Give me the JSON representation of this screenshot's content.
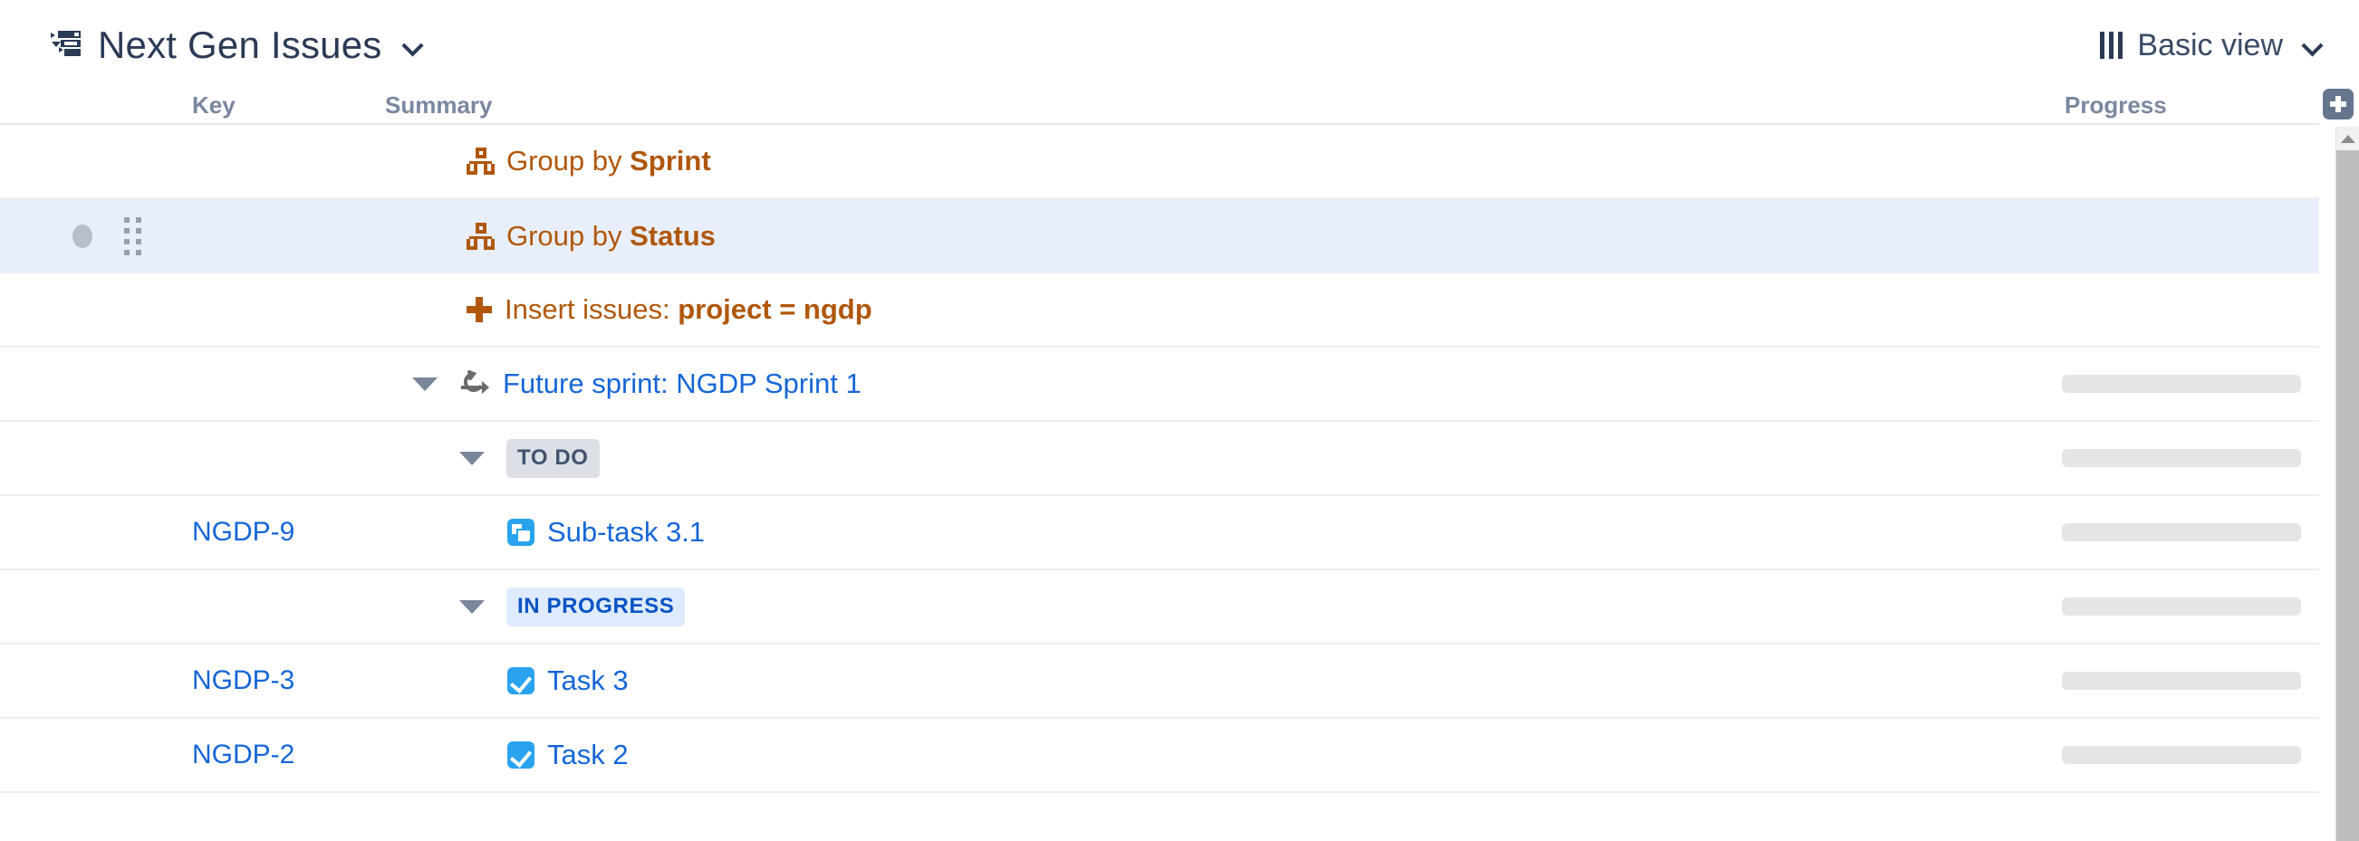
{
  "header": {
    "title": "Next Gen Issues",
    "title_icon": "structure-tree-icon",
    "title_chevron": "chevron-down-icon",
    "view_label": "Basic view",
    "view_icon": "columns-bars-icon",
    "view_chevron": "chevron-down-icon"
  },
  "columns": {
    "key": "Key",
    "summary": "Summary",
    "progress": "Progress",
    "add_column": "add-column-icon"
  },
  "colors": {
    "link_blue": "#1566d6",
    "group_orange": "#b0570b",
    "selected_row": "#e9effa",
    "badge_todo_bg": "#dcdfe6",
    "badge_todo_fg": "#42526e",
    "badge_progress_bg": "#deebff",
    "badge_progress_fg": "#0a53c4",
    "progress_track": "#e4e5e7",
    "header_text": "#7a87a0",
    "title_navy": "#2b3a55"
  },
  "rows": [
    {
      "type": "group-by",
      "indent": 0,
      "key": "",
      "icon": "group-hierarchy-icon",
      "prefix": "Group by ",
      "strong": "Sprint",
      "selected": false,
      "progress": false
    },
    {
      "type": "group-by",
      "indent": 0,
      "key": "",
      "icon": "group-hierarchy-icon",
      "prefix": "Group by ",
      "strong": "Status",
      "selected": true,
      "progress": false
    },
    {
      "type": "insert-issues",
      "indent": 0,
      "key": "",
      "icon": "plus-icon",
      "prefix": "Insert issues: ",
      "strong": "project = ngdp",
      "selected": false,
      "progress": false
    },
    {
      "type": "sprint",
      "indent": 1,
      "key": "",
      "icon": "sprint-icon",
      "twisty": "triangle-down-icon",
      "label": "Future sprint: NGDP Sprint 1",
      "selected": false,
      "progress": true
    },
    {
      "type": "status-group",
      "indent": 2,
      "key": "",
      "twisty": "triangle-down-icon",
      "badge": "TO DO",
      "badge_style": "todo",
      "selected": false,
      "progress": true
    },
    {
      "type": "issue",
      "indent": 3,
      "key": "NGDP-9",
      "icon": "subtask-icon",
      "label": "Sub-task 3.1",
      "selected": false,
      "progress": true
    },
    {
      "type": "status-group",
      "indent": 2,
      "key": "",
      "twisty": "triangle-down-icon",
      "badge": "IN PROGRESS",
      "badge_style": "progress",
      "selected": false,
      "progress": true
    },
    {
      "type": "issue",
      "indent": 3,
      "key": "NGDP-3",
      "icon": "task-icon",
      "label": "Task 3",
      "selected": false,
      "progress": true
    },
    {
      "type": "issue",
      "indent": 3,
      "key": "NGDP-2",
      "icon": "task-icon",
      "label": "Task 2",
      "selected": false,
      "progress": true
    }
  ]
}
